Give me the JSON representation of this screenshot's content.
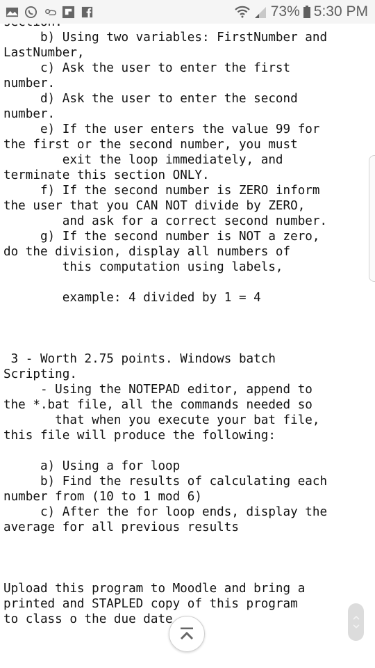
{
  "status_bar": {
    "notification_icons": [
      "gallery-icon",
      "whatsapp-icon",
      "weather-icon",
      "flipboard-icon",
      "facebook-icon"
    ],
    "wifi": "wifi-icon",
    "signal": "signal-icon",
    "battery_percent": "73%",
    "time": "5:30 PM"
  },
  "document": {
    "lines": [
      "section.",
      "     b) Using two variables: FirstNumber and",
      "LastNumber,",
      "     c) Ask the user to enter the first",
      "number.",
      "     d) Ask the user to enter the second",
      "number.",
      "     e) If the user enters the value 99 for",
      "the first or the second number, you must",
      "        exit the loop immediately, and",
      "terminate this section ONLY.",
      "     f) If the second number is ZERO inform",
      "the user that you CAN NOT divide by ZERO,",
      "        and ask for a correct second number.",
      "     g) If the second number is NOT a zero,",
      "do the division, display all numbers of",
      "        this computation using labels,",
      "",
      "        example: 4 divided by 1 = 4",
      "",
      "",
      "",
      " 3 - Worth 2.75 points. Windows batch",
      "Scripting.",
      "     - Using the NOTEPAD editor, append to",
      "the *.bat file, all the commands needed so",
      "       that when you execute your bat file,",
      "this file will produce the following:",
      "",
      "     a) Using a for loop",
      "     b) Find the results of calculating each",
      "number from (10 to 1 mod 6)",
      "     c) After the for loop ends, display the",
      "average for all previous results",
      "",
      "",
      "",
      "Upload this program to Moodle and bring a",
      "printed and STAPLED copy of this program",
      "to class o the due date"
    ]
  },
  "controls": {
    "scroll_to_top": "chevron-up-icon",
    "page_up": "chevron-up-icon",
    "page_down": "chevron-down-icon"
  }
}
